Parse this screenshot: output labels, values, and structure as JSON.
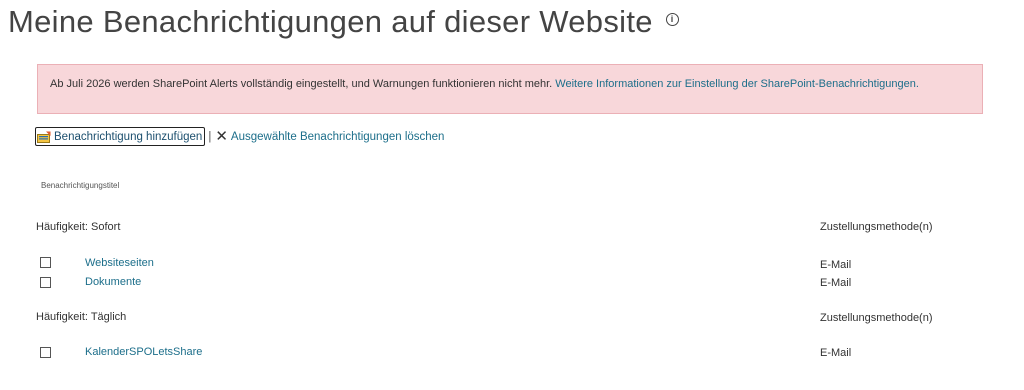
{
  "page": {
    "title": "Meine Benachrichtigungen auf dieser Website",
    "info_icon_glyph": "i"
  },
  "alert": {
    "text": "Ab Juli 2026 werden SharePoint Alerts vollständig eingestellt, und Warnungen funktionieren nicht mehr. ",
    "link_text": "Weitere Informationen zur Einstellung der SharePoint-Benachrichtigungen.",
    "background_color": "#f8d7da"
  },
  "toolbar": {
    "add_label": "Benachrichtigung hinzufügen",
    "separator": "|",
    "delete_label": "Ausgewählte Benachrichtigungen löschen",
    "delete_icon": "close-icon",
    "add_icon": "add-alert-icon"
  },
  "table": {
    "column_title": "Benachrichtigungstitel",
    "groups": [
      {
        "frequency": "Häufigkeit: Sofort",
        "method_header": "Zustellungsmethode(n)",
        "rows": [
          {
            "title": "Websiteseiten",
            "method": "E-Mail",
            "checked": false
          },
          {
            "title": "Dokumente",
            "method": "E-Mail",
            "checked": false
          }
        ]
      },
      {
        "frequency": "Häufigkeit: Täglich",
        "method_header": "Zustellungsmethode(n)",
        "rows": [
          {
            "title": "KalenderSPOLetsShare",
            "method": "E-Mail",
            "checked": false
          }
        ]
      }
    ]
  },
  "colors": {
    "link": "#1c6e8a",
    "text": "#333333"
  }
}
